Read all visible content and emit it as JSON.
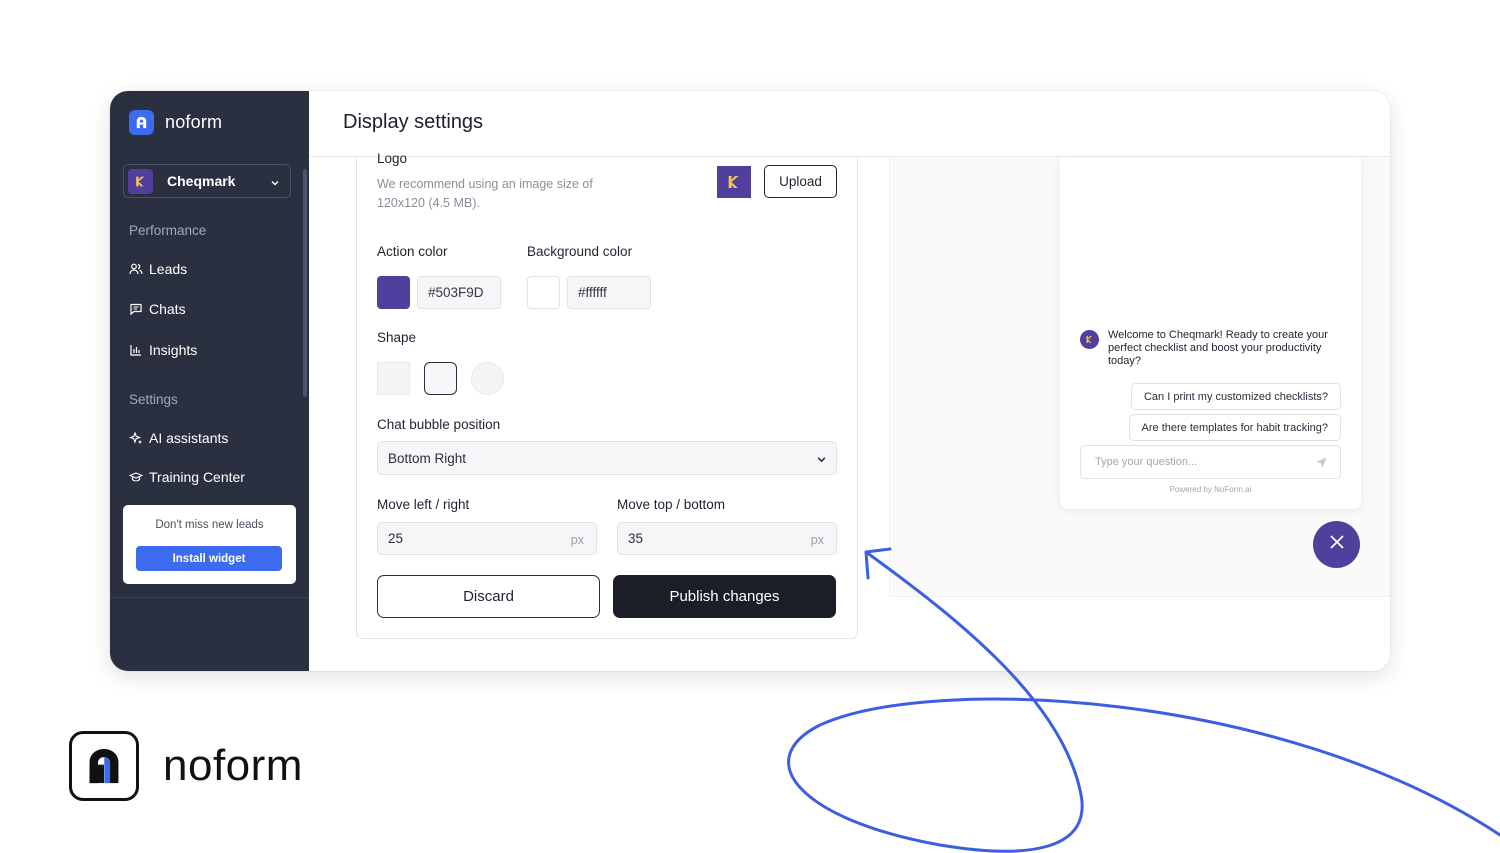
{
  "brand": {
    "name": "noform"
  },
  "sidebar": {
    "workspace": {
      "name": "Cheqmark",
      "initial": "K"
    },
    "sections": {
      "performance": "Performance",
      "settings": "Settings"
    },
    "items": {
      "leads": "Leads",
      "chats": "Chats",
      "insights": "Insights",
      "ai_assistants": "AI assistants",
      "training_center": "Training Center"
    },
    "promo": {
      "text": "Don't miss new leads",
      "button": "Install widget"
    }
  },
  "header": {
    "title": "Display settings"
  },
  "form": {
    "logo": {
      "label": "Logo",
      "hint": "We recommend using an image size of 120x120 (4.5 MB).",
      "upload_label": "Upload"
    },
    "action_color": {
      "label": "Action color",
      "value": "#503F9D"
    },
    "background_color": {
      "label": "Background color",
      "value": "#ffffff"
    },
    "shape": {
      "label": "Shape",
      "options": [
        "square",
        "rounded",
        "circle"
      ],
      "selected": "rounded"
    },
    "position": {
      "label": "Chat bubble position",
      "value": "Bottom Right"
    },
    "move_lr": {
      "label": "Move left / right",
      "value": "25",
      "unit": "px"
    },
    "move_tb": {
      "label": "Move top / bottom",
      "value": "35",
      "unit": "px"
    },
    "discard_label": "Discard",
    "publish_label": "Publish changes"
  },
  "preview": {
    "bot_initial": "K",
    "welcome": "Welcome to Cheqmark! Ready to create your perfect checklist and boost your productivity today?",
    "suggestions": [
      "Can I print my customized checklists?",
      "Are there templates for habit tracking?"
    ],
    "input_placeholder": "Type your question...",
    "powered_by": "Powered by NoForm.ai"
  },
  "colors": {
    "accent": "#503F9D",
    "sidebar_bg": "#2b3040",
    "primary_blue": "#3c6bf0",
    "publish_bg": "#1b1e26",
    "annotation_stroke": "#3b5fe0"
  },
  "icons": {
    "brand": "noform-logo-icon",
    "leads": "users-icon",
    "chats": "message-square-icon",
    "insights": "bar-chart-icon",
    "ai_assistants": "sparkles-icon",
    "training_center": "graduation-cap-icon",
    "dropdown": "chevron-down-icon",
    "send": "send-icon",
    "close": "close-icon"
  }
}
